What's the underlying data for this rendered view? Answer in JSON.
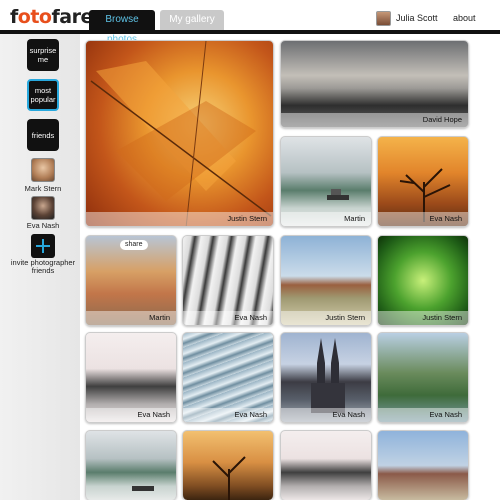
{
  "app": {
    "logo_part1": "f",
    "logo_part2": "oto",
    "logo_part3": "fare"
  },
  "header": {
    "tabs": [
      {
        "label": "Browse photos",
        "active": true
      },
      {
        "label": "My gallery",
        "active": false
      }
    ],
    "user_name": "Julia Scott",
    "about_label": "about"
  },
  "sidebar": {
    "buttons": [
      {
        "label": "surprise me"
      },
      {
        "label": "most popular",
        "active": true
      },
      {
        "label": "friends"
      }
    ],
    "friends": [
      {
        "name": "Mark Stern"
      },
      {
        "name": "Eva Nash"
      }
    ],
    "invite_label": "invite photographer friends"
  },
  "photos": [
    {
      "author": "Justin Stern",
      "theme": "autumn leaf"
    },
    {
      "author": "David Hope",
      "theme": "rocky coast"
    },
    {
      "author": "Martin",
      "theme": "misty bay"
    },
    {
      "author": "Eva Nash",
      "theme": "sunset tree"
    },
    {
      "author": "Martin",
      "theme": "harbor town",
      "share_label": "share"
    },
    {
      "author": "Eva Nash",
      "theme": "architecture"
    },
    {
      "author": "Justin Stern",
      "theme": "desert"
    },
    {
      "author": "Justin Stern",
      "theme": "green plant"
    },
    {
      "author": "Eva Nash",
      "theme": "misty tree"
    },
    {
      "author": "Eva Nash",
      "theme": "ice"
    },
    {
      "author": "Eva Nash",
      "theme": "cathedral"
    },
    {
      "author": "Eva Nash",
      "theme": "cliffs"
    },
    {
      "author": "",
      "theme": "misty bay"
    },
    {
      "author": "",
      "theme": "sunset tree"
    },
    {
      "author": "",
      "theme": "misty tree"
    },
    {
      "author": "",
      "theme": "desert"
    }
  ],
  "colors": {
    "accent_blue": "#28a8dd",
    "logo_orange": "#e84f1c",
    "tab_active_bg": "#111111",
    "tab_inactive_bg": "#c9c9c9"
  }
}
